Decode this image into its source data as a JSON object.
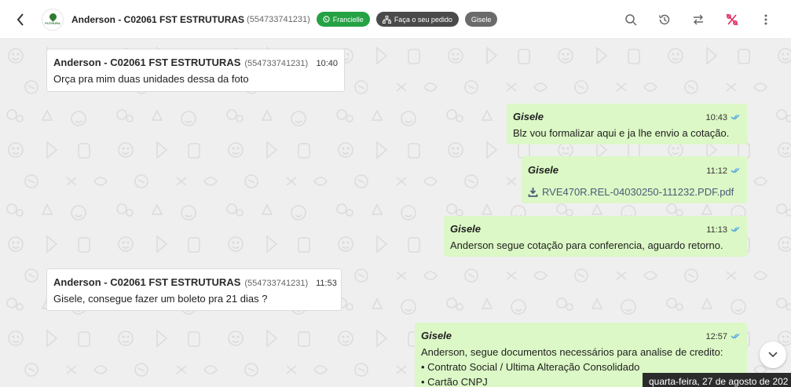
{
  "header": {
    "avatar_brand": "PUTHURA",
    "contact_name": "Anderson - C02061 FST ESTRUTURAS",
    "contact_phone": "(554733741231)",
    "tags": [
      "Francielle",
      "Faça o seu pedido",
      "Gisele"
    ],
    "icons": [
      "back-arrow",
      "search",
      "history",
      "transfer",
      "percent-crossed",
      "more-vertical"
    ]
  },
  "messages": [
    {
      "dir": "in",
      "sender": "Anderson - C02061 FST ESTRUTURAS",
      "phone": "(554733741231)",
      "time": "10:40",
      "text": "Orça pra mim duas unidades dessa da foto"
    },
    {
      "dir": "out",
      "sender": "Gisele",
      "time": "10:43",
      "text": "Blz vou formalizar aqui e ja lhe envio a cotação."
    },
    {
      "dir": "out",
      "sender": "Gisele",
      "time": "11:12",
      "file": "RVE470R.REL-04030250-111232.PDF.pdf"
    },
    {
      "dir": "out",
      "sender": "Gisele",
      "time": "11:13",
      "text": "Anderson segue cotação para conferencia, aguardo retorno."
    },
    {
      "dir": "in",
      "sender": "Anderson - C02061 FST ESTRUTURAS",
      "phone": "(554733741231)",
      "time": "11:53",
      "text": "Gisele, consegue fazer um boleto pra 21 dias ?"
    },
    {
      "dir": "out",
      "sender": "Gisele",
      "time": "12:57",
      "lines": [
        "Anderson, segue documentos necessários para analise de credito:",
        "• Contrato Social / Ultima Alteração Consolidado",
        "• Cartão CNPJ"
      ]
    }
  ],
  "date_chip": "quarta-feira, 27 de agosto de 202",
  "colors": {
    "outgoing_bubble": "#dcf8c6",
    "incoming_bubble": "#ffffff",
    "tag_green": "#25a244",
    "read_ticks": "#4fa3e0",
    "percent_icon": "#e0245e"
  }
}
